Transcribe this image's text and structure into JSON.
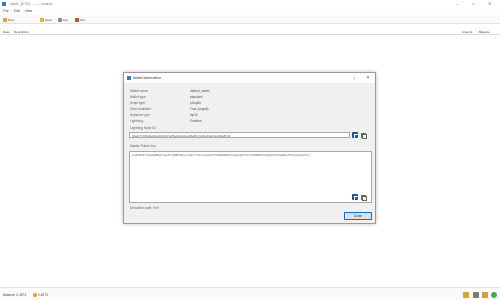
{
  "window": {
    "title": "Vault - [KTS] - ... — vault.kt",
    "min": "–",
    "max": "□",
    "close": "✕"
  },
  "menu": [
    "File",
    "Edit",
    "View"
  ],
  "toolbar": {
    "add_label": "New",
    "save_label": "Open",
    "key_label": "Key",
    "item4_label": "Sort"
  },
  "columns": {
    "date": "Date",
    "description": "Description",
    "amount": "Amount",
    "balance": "Balance"
  },
  "status": {
    "left": "Balance: 0.4573",
    "middle": "0.4573"
  },
  "dialog": {
    "title": "Wallet information",
    "help": "?",
    "close": "✕",
    "fields": [
      {
        "label": "Wallet name:",
        "value": "default_wallet"
      },
      {
        "label": "Wallet type:",
        "value": "standard"
      },
      {
        "label": "Script type:",
        "value": "p2wpkh"
      },
      {
        "label": "Seed available:",
        "value": "True (segwit)"
      },
      {
        "label": "Keystore type:",
        "value": "bip32"
      },
      {
        "label": "Lightning:",
        "value": "Enabled"
      }
    ],
    "lightning_node_id_label": "Lightning Node ID:",
    "lightning_node_id": "03a4cf7c6b5d3e2f1a0b9c8d7e6f5a4b3c2d1e0f9a8b7c6d5e4f3a2b1c0d9e8f7a6",
    "master_pubkey_label": "Master Public Key",
    "master_pubkey": "zpub6rFR7y4Q2AijBEqTUquhVz398htDFrtymD9xYYfG1m4wAcvPhXNfE3EfH1r1ADqtfSdVCToUG868RvUUkgDKf31mGDtKsAYz2oz2AGutZYs",
    "derivation_path_label": "Derivation path: m/0'",
    "close_button": "Close"
  }
}
